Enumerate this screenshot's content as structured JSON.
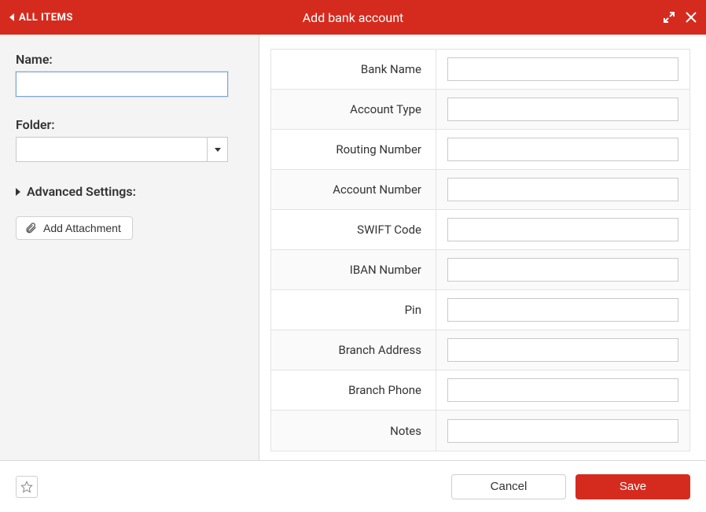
{
  "colors": {
    "brand": "#d52b1e"
  },
  "header": {
    "back_label": "ALL ITEMS",
    "title": "Add bank account"
  },
  "left": {
    "name_label": "Name:",
    "name_value": "",
    "folder_label": "Folder:",
    "folder_value": "",
    "advanced_label": "Advanced Settings:",
    "attach_label": "Add Attachment"
  },
  "fields": [
    {
      "label": "Bank Name",
      "value": ""
    },
    {
      "label": "Account Type",
      "value": ""
    },
    {
      "label": "Routing Number",
      "value": ""
    },
    {
      "label": "Account Number",
      "value": ""
    },
    {
      "label": "SWIFT Code",
      "value": ""
    },
    {
      "label": "IBAN Number",
      "value": ""
    },
    {
      "label": "Pin",
      "value": ""
    },
    {
      "label": "Branch Address",
      "value": ""
    },
    {
      "label": "Branch Phone",
      "value": ""
    },
    {
      "label": "Notes",
      "value": ""
    }
  ],
  "footer": {
    "cancel_label": "Cancel",
    "save_label": "Save"
  }
}
